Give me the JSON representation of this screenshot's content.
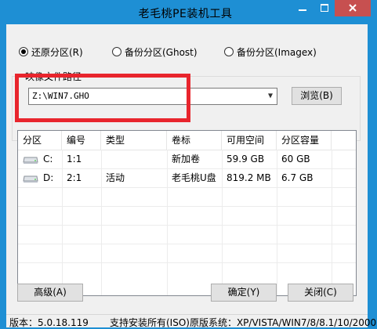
{
  "window": {
    "title": "老毛桃PE装机工具",
    "controls": {
      "minimize": "minimize-icon",
      "maximize": "maximize-icon",
      "close": "close-icon"
    }
  },
  "mode_options": [
    {
      "label": "还原分区(R)",
      "selected": true
    },
    {
      "label": "备份分区(Ghost)",
      "selected": false
    },
    {
      "label": "备份分区(Imagex)",
      "selected": false
    }
  ],
  "image_path": {
    "group_title": "映像文件路径",
    "value": "Z:\\WIN7.GHO",
    "browse_label": "浏览(B)"
  },
  "highlight_color": "#e8252d",
  "partition_table": {
    "columns": [
      "分区",
      "编号",
      "类型",
      "卷标",
      "可用空间",
      "分区容量"
    ],
    "rows": [
      {
        "drive": "C:",
        "number": "1:1",
        "type": "",
        "label": "新加卷",
        "free": "59.9 GB",
        "capacity": "60 GB"
      },
      {
        "drive": "D:",
        "number": "2:1",
        "type": "活动",
        "label": "老毛桃U盘",
        "free": "819.2 MB",
        "capacity": "6.7 GB"
      }
    ]
  },
  "buttons": {
    "advanced": "高级(A)",
    "ok": "确定(Y)",
    "close": "关闭(C)"
  },
  "status": {
    "version": "版本：5.0.18.119",
    "support": "支持安装所有(ISO)原版系统：XP/VISTA/WIN7/8/8.1/10/2000"
  }
}
